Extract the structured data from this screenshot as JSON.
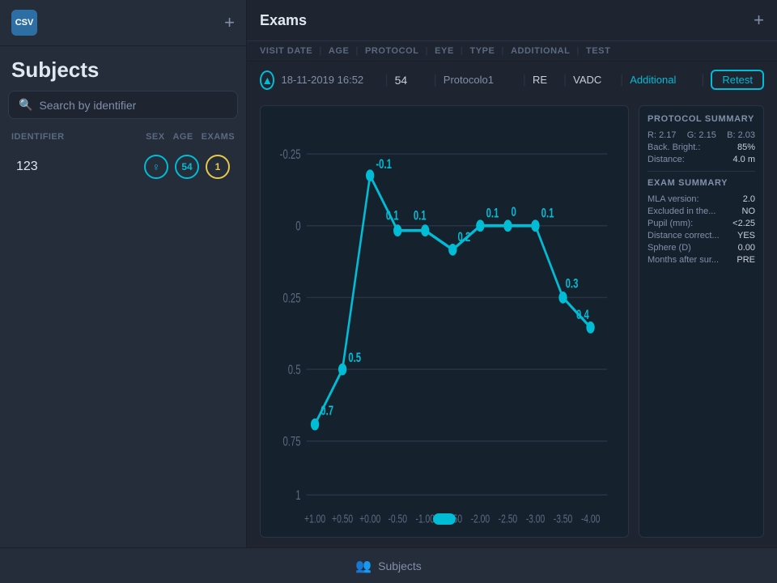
{
  "sidebar": {
    "logo_text": "CSV",
    "add_btn_label": "+",
    "title": "Subjects",
    "search_placeholder": "Search by identifier",
    "table_headers": {
      "identifier": "IDENTIFIER",
      "sex": "SEX",
      "age": "AGE",
      "exams": "EXAMS"
    },
    "subjects": [
      {
        "id": "123",
        "sex_icon": "♀",
        "age": "54",
        "exams": "1"
      }
    ]
  },
  "main": {
    "title": "Exams",
    "add_btn_label": "+",
    "column_headers": [
      "VISIT DATE",
      "AGE",
      "PROTOCOL",
      "EYE",
      "TYPE",
      "ADDITIONAL",
      "TEST"
    ],
    "exam": {
      "date": "18-11-2019 16:52",
      "age": "54",
      "protocol": "Protocolo1",
      "eye": "RE",
      "vadc": "VADC",
      "additional": "Additional",
      "retest_label": "Retest"
    },
    "protocol_summary": {
      "title": "PROTOCOL SUMMARY",
      "r_label": "R:",
      "r_value": "2.17",
      "g_label": "G:",
      "g_value": "2.15",
      "b_label": "B:",
      "b_value": "2.03",
      "back_bright_label": "Back. Bright.:",
      "back_bright_value": "85%",
      "distance_label": "Distance:",
      "distance_value": "4.0 m"
    },
    "exam_summary": {
      "title": "EXAM SUMMARY",
      "mla_label": "MLA version:",
      "mla_value": "2.0",
      "excluded_label": "Excluded in the...",
      "excluded_value": "NO",
      "pupil_label": "Pupil (mm):",
      "pupil_value": "<2.25",
      "distance_correct_label": "Distance correct...",
      "distance_correct_value": "YES",
      "sphere_label": "Sphere (D)",
      "sphere_value": "0.00",
      "months_label": "Months after sur...",
      "months_value": "PRE"
    },
    "chart": {
      "x_labels": [
        "+1.00",
        "+0.50",
        "+0.00",
        "-0.50",
        "-1.00",
        "-1.50",
        "-2.00",
        "-2.50",
        "-3.00",
        "-3.50",
        "-4.00"
      ],
      "y_labels": [
        "-0.25",
        "0",
        "0.25",
        "0.5",
        "0.75",
        "1"
      ],
      "points": [
        {
          "x": "+1.00",
          "y": 0.75,
          "label": "0.7"
        },
        {
          "x": "+0.50",
          "y": 0.5,
          "label": "0.5"
        },
        {
          "x": "+0.00",
          "y": -0.1,
          "label": "-0.1"
        },
        {
          "x": "-0.50",
          "y": 0.1,
          "label": "0.1"
        },
        {
          "x": "-1.00",
          "y": 0.1,
          "label": "0.1"
        },
        {
          "x": "-1.50",
          "y": 0.2,
          "label": "0.2"
        },
        {
          "x": "-2.00",
          "y": 0.1,
          "label": "0.1"
        },
        {
          "x": "-2.50",
          "y": 0.0,
          "label": "0"
        },
        {
          "x": "-3.00",
          "y": 0.1,
          "label": "0.1"
        },
        {
          "x": "-3.50",
          "y": 0.3,
          "label": "0.3"
        },
        {
          "x": "-4.00",
          "y": 0.4,
          "label": "0.4"
        }
      ]
    }
  },
  "bottom_bar": {
    "icon": "👥",
    "label": "Subjects"
  }
}
